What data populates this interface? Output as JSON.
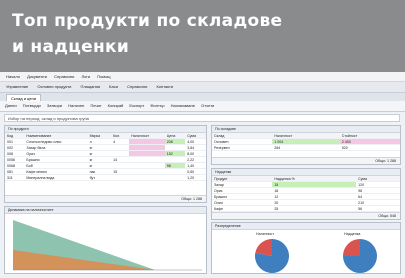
{
  "banner": {
    "title": "Топ продукти по складове\nи надценки",
    "bg": "#8a8b8d"
  },
  "menu": [
    "Начало",
    "Документи",
    "Справочни",
    "Логи",
    "Помощ"
  ],
  "toolbar": [
    "Управление",
    "Основни продукти",
    "Плащания",
    "Каси",
    "Справочни",
    "Контакти"
  ],
  "tab": "Склад и цени",
  "toolbar2": [
    "Данни",
    "Потвърди",
    "Затвори",
    "Наличен",
    "Печат",
    "Копирай",
    "Експорт",
    "Филтър",
    "Назначаване",
    "Отчети"
  ],
  "filter_text": "Избор на период, склад и продуктова група",
  "left_panel": {
    "title": "По продукти",
    "headers": [
      "Код",
      "Наименование",
      "Мярка",
      "Кол.",
      "Наличност",
      "Цена",
      "Сума"
    ],
    "rows": [
      [
        "001",
        "Слънчогледово олио",
        "л",
        "4",
        "",
        "208",
        "4,00"
      ],
      [
        "002",
        "Захар бяла",
        "кг",
        "",
        "",
        "",
        "3,84"
      ],
      [
        "008",
        "Ориз",
        "кг",
        "",
        "",
        "152",
        "8,00"
      ],
      [
        "0056",
        "Брашно",
        "кг",
        "14",
        "",
        "",
        "2,22"
      ],
      [
        "0068",
        "Боб",
        "кг",
        "",
        "",
        "98",
        "1,40"
      ],
      [
        "081",
        "Кафе мляно",
        "пак",
        "15",
        "",
        "",
        "0,60"
      ],
      [
        "311",
        "Минерална вода",
        "бут",
        "",
        "",
        "",
        "1,20"
      ]
    ],
    "footer": "Общо: 1 288"
  },
  "right_top": {
    "title": "По складове",
    "headers": [
      "Склад",
      "Наличност",
      "Стойност"
    ],
    "rows": [
      [
        "Основен",
        "1 004",
        "2 400"
      ],
      [
        "Резервен",
        "284",
        "520"
      ]
    ],
    "footer": "Общо: 1 288"
  },
  "right_mid": {
    "title": "Надценки",
    "headers": [
      "Продукт",
      "Надценка %",
      "Сума"
    ],
    "rows": [
      [
        "Захар",
        "15",
        "120"
      ],
      [
        "Ориз",
        "18",
        "98"
      ],
      [
        "Брашно",
        "12",
        "64"
      ],
      [
        "Олио",
        "20",
        "210"
      ],
      [
        "Кафе",
        "25",
        "56"
      ]
    ],
    "footer": "Общо: 548"
  },
  "bottom_left_title": "Динамика на наличностите",
  "bottom_right_title": "Разпределение",
  "pie_legends": [
    "Наличност",
    "Надценка"
  ],
  "chart_data": [
    {
      "type": "area",
      "series": [
        {
          "values": [
            100,
            80,
            60,
            40,
            20,
            0
          ]
        },
        {
          "values": [
            40,
            32,
            24,
            16,
            8,
            0
          ]
        }
      ]
    },
    {
      "type": "pie",
      "values": [
        78,
        22
      ],
      "colors": [
        "#3f7fbf",
        "#d9534f"
      ]
    },
    {
      "type": "pie",
      "values": [
        75,
        25
      ],
      "colors": [
        "#3f7fbf",
        "#d9534f"
      ]
    }
  ],
  "colors": {
    "accent_green": "#c9efb8",
    "accent_pink": "#f6c7e4",
    "area_green": "#79b9a1",
    "area_orange": "#e08a4c"
  }
}
